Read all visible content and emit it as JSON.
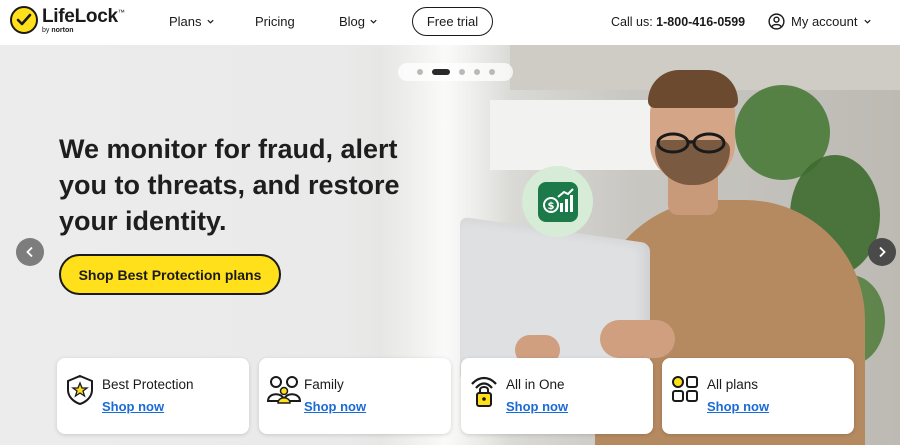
{
  "brand": {
    "name": "LifeLock",
    "trademark": "™",
    "byline_prefix": "by",
    "byline_brand": "norton"
  },
  "nav": {
    "plans": "Plans",
    "pricing": "Pricing",
    "blog": "Blog",
    "free_trial": "Free trial"
  },
  "contact": {
    "label": "Call us:",
    "phone": "1-800-416-0599"
  },
  "account": {
    "label": "My account"
  },
  "hero": {
    "headline": "We monitor for fraud, alert you to threats, and restore your identity.",
    "cta_label": "Shop Best Protection plans"
  },
  "carousel": {
    "slides": 5,
    "active_index": 1
  },
  "cards": [
    {
      "title": "Best Protection",
      "link": "Shop now",
      "icon": "shield-star-icon"
    },
    {
      "title": "Family",
      "link": "Shop now",
      "icon": "family-icon"
    },
    {
      "title": "All in One",
      "link": "Shop now",
      "icon": "wifi-lock-icon"
    },
    {
      "title": "All plans",
      "link": "Shop now",
      "icon": "grid-icon"
    }
  ],
  "colors": {
    "brand_yellow": "#ffe01b",
    "link_blue": "#1a6bd6",
    "money_green": "#1c7a4a"
  }
}
